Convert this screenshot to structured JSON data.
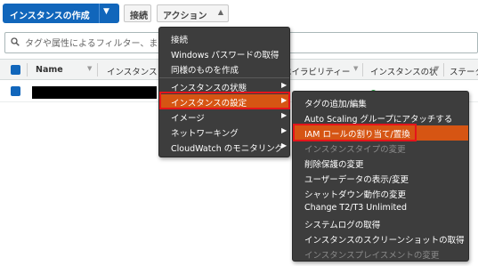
{
  "toolbar": {
    "launch_label": "インスタンスの作成",
    "connect_label": "接続",
    "actions_label": "アクション"
  },
  "search": {
    "placeholder": "タグや属性によるフィルター、ま"
  },
  "table": {
    "columns": [
      "Name",
      "インスタンス ID",
      "ベイラビリティー",
      "インスタンスの状",
      "ステータ"
    ]
  },
  "actions_menu": {
    "items": [
      {
        "label": "接続",
        "submenu": false
      },
      {
        "label": "Windows パスワードの取得",
        "submenu": false
      },
      {
        "label": "同様のものを作成",
        "submenu": false
      },
      {
        "label": "インスタンスの状態",
        "submenu": true
      },
      {
        "label": "インスタンスの設定",
        "submenu": true,
        "active": true
      },
      {
        "label": "イメージ",
        "submenu": true
      },
      {
        "label": "ネットワーキング",
        "submenu": true
      },
      {
        "label": "CloudWatch のモニタリング",
        "submenu": true
      }
    ]
  },
  "settings_submenu": {
    "items": [
      {
        "label": "タグの追加/編集",
        "disabled": false
      },
      {
        "label": "Auto Scaling グループにアタッチする",
        "disabled": false
      },
      {
        "label": "IAM ロールの割り当て/置換",
        "disabled": false,
        "highlighted": true
      },
      {
        "label": "インスタンスタイプの変更",
        "disabled": true
      },
      {
        "label": "削除保護の変更",
        "disabled": false
      },
      {
        "label": "ユーザーデータの表示/変更",
        "disabled": false
      },
      {
        "label": "シャットダウン動作の変更",
        "disabled": false
      },
      {
        "label": "Change T2/T3 Unlimited",
        "disabled": false
      },
      {
        "label": "システムログの取得",
        "disabled": false
      },
      {
        "label": "インスタンスのスクリーンショットの取得",
        "disabled": false
      },
      {
        "label": "インスタンスプレイスメントの変更",
        "disabled": true
      }
    ]
  },
  "colors": {
    "primary": "#1166bb",
    "menu_bg": "#3d3d3d",
    "menu_active": "#d65513",
    "callout_red": "#e5141b"
  }
}
